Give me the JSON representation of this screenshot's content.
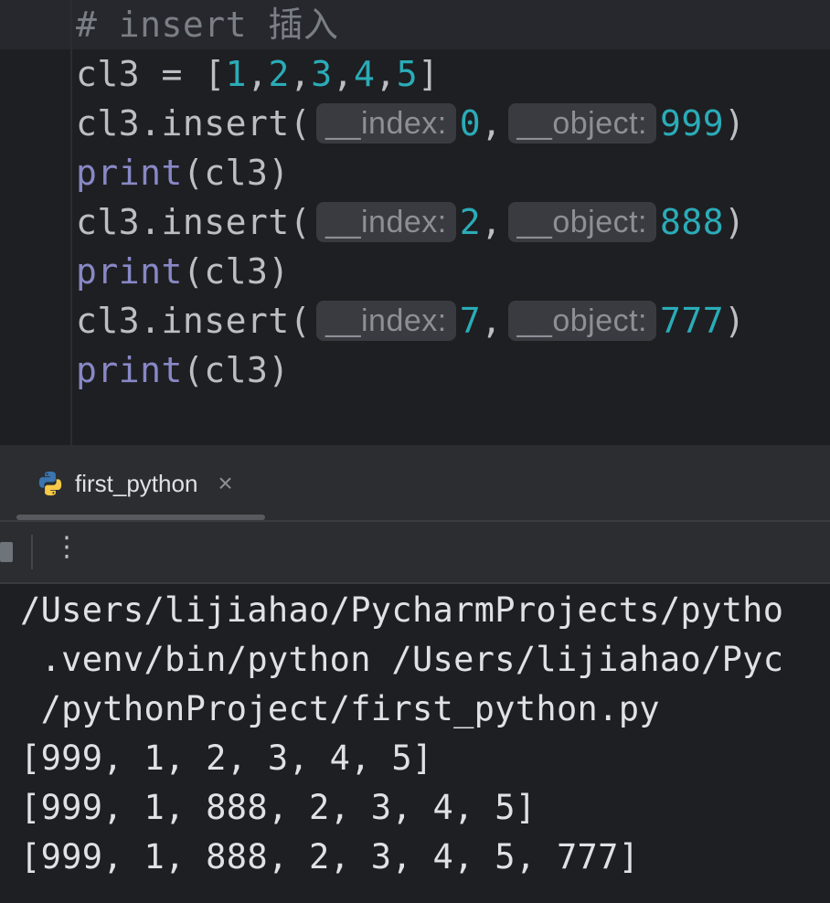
{
  "editor": {
    "comment": "# insert 插入",
    "line_assign": {
      "var": "cl3 = [",
      "nums": [
        "1",
        "2",
        "3",
        "4",
        "5"
      ],
      "close": "]"
    },
    "calls": [
      {
        "prefix": "cl3.insert(",
        "hint_index": "__index:",
        "index": "0",
        "comma": ",",
        "hint_object": "__object:",
        "object": "999",
        "close": ")"
      },
      {
        "prefix": "cl3.insert(",
        "hint_index": "__index:",
        "index": "2",
        "comma": ",",
        "hint_object": "__object:",
        "object": "888",
        "close": ")"
      },
      {
        "prefix": "cl3.insert(",
        "hint_index": "__index:",
        "index": "7",
        "comma": ",",
        "hint_object": "__object:",
        "object": "777",
        "close": ")"
      }
    ],
    "print_fn": "print",
    "print_arg": "(cl3)"
  },
  "run_panel": {
    "tab_label": "first_python",
    "close_glyph": "×",
    "kebab_glyph": "⋮"
  },
  "console": {
    "lines": [
      "/Users/lijiahao/PycharmProjects/pytho",
      " .venv/bin/python /Users/lijiahao/Pyc",
      " /pythonProject/first_python.py",
      "[999, 1, 2, 3, 4, 5]",
      "[999, 1, 888, 2, 3, 4, 5]",
      "[999, 1, 888, 2, 3, 4, 5, 777]"
    ]
  },
  "colors": {
    "editor_bg": "#1e1f22",
    "number": "#2aacb8",
    "builtin": "#8888c6",
    "comment": "#7a7e85"
  }
}
